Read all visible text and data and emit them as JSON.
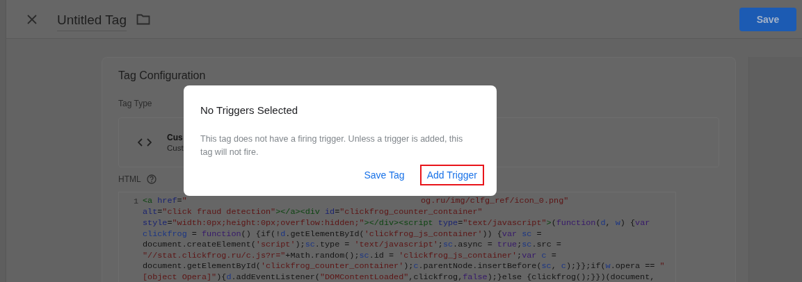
{
  "header": {
    "title": "Untitled Tag",
    "save_button": "Save"
  },
  "card": {
    "title": "Tag Configuration",
    "tag_type_label": "Tag Type",
    "tag_type": {
      "name": "Cus",
      "description": "Cust"
    },
    "html_label": "HTML"
  },
  "code": {
    "lines": [
      {
        "number": "1",
        "runs": [
          [
            {
              "text": "<a",
              "kind": "tag"
            },
            {
              "text": " href",
              "kind": "attr"
            },
            {
              "text": "=",
              "kind": "plain"
            },
            {
              "text": "\"",
              "kind": "string"
            }
          ],
          [
            {
              "text": "og.ru/img/clfg_ref/icon_0.png\"",
              "kind": "string"
            }
          ]
        ]
      },
      {
        "runs": [
          [
            {
              "text": "alt",
              "kind": "attr"
            },
            {
              "text": "=",
              "kind": "plain"
            },
            {
              "text": "\"click fraud detection\"",
              "kind": "string"
            },
            {
              "text": "></a><div",
              "kind": "tag"
            },
            {
              "text": " id",
              "kind": "attr"
            },
            {
              "text": "=",
              "kind": "plain"
            },
            {
              "text": "\"clickfrog_counter_container\"",
              "kind": "string"
            }
          ]
        ]
      },
      {
        "runs": [
          [
            {
              "text": "style",
              "kind": "attr"
            },
            {
              "text": "=",
              "kind": "plain"
            },
            {
              "text": "\"width:0px;height:0px;overflow:hidden;\"",
              "kind": "string"
            },
            {
              "text": "></div><script",
              "kind": "tag"
            },
            {
              "text": " type",
              "kind": "attr"
            },
            {
              "text": "=",
              "kind": "plain"
            },
            {
              "text": "\"text/javascript\"",
              "kind": "string"
            },
            {
              "text": ">",
              "kind": "tag"
            },
            {
              "text": "(",
              "kind": "plain"
            },
            {
              "text": "function",
              "kind": "keyword"
            },
            {
              "text": "(",
              "kind": "plain"
            },
            {
              "text": "d",
              "kind": "var"
            },
            {
              "text": ", ",
              "kind": "plain"
            },
            {
              "text": "w",
              "kind": "var"
            },
            {
              "text": ") {",
              "kind": "plain"
            },
            {
              "text": "var",
              "kind": "keyword"
            }
          ]
        ]
      },
      {
        "runs": [
          [
            {
              "text": "clickfrog",
              "kind": "var"
            },
            {
              "text": " = ",
              "kind": "plain"
            },
            {
              "text": "function",
              "kind": "keyword"
            },
            {
              "text": "() {if(!",
              "kind": "plain"
            },
            {
              "text": "d",
              "kind": "var"
            },
            {
              "text": ".getElementById(",
              "kind": "plain"
            },
            {
              "text": "'clickfrog_js_container'",
              "kind": "string"
            },
            {
              "text": ")) {",
              "kind": "plain"
            },
            {
              "text": "var",
              "kind": "keyword"
            },
            {
              "text": " sc",
              "kind": "var"
            },
            {
              "text": " =",
              "kind": "plain"
            }
          ]
        ]
      },
      {
        "runs": [
          [
            {
              "text": "document.createElement(",
              "kind": "plain"
            },
            {
              "text": "'script'",
              "kind": "string"
            },
            {
              "text": ");",
              "kind": "plain"
            },
            {
              "text": "sc",
              "kind": "var"
            },
            {
              "text": ".type = ",
              "kind": "plain"
            },
            {
              "text": "'text/javascript'",
              "kind": "string"
            },
            {
              "text": ";",
              "kind": "plain"
            },
            {
              "text": "sc",
              "kind": "var"
            },
            {
              "text": ".async = ",
              "kind": "plain"
            },
            {
              "text": "true",
              "kind": "keyword"
            },
            {
              "text": ";",
              "kind": "plain"
            },
            {
              "text": "sc",
              "kind": "var"
            },
            {
              "text": ".src =",
              "kind": "plain"
            }
          ]
        ]
      },
      {
        "runs": [
          [
            {
              "text": "\"//stat.clickfrog.ru/c.js?r=\"",
              "kind": "string"
            },
            {
              "text": "+Math.random();",
              "kind": "plain"
            },
            {
              "text": "sc",
              "kind": "var"
            },
            {
              "text": ".id = ",
              "kind": "plain"
            },
            {
              "text": "'clickfrog_js_container'",
              "kind": "string"
            },
            {
              "text": ";",
              "kind": "plain"
            },
            {
              "text": "var",
              "kind": "keyword"
            },
            {
              "text": " c",
              "kind": "var"
            },
            {
              "text": " =",
              "kind": "plain"
            }
          ]
        ]
      },
      {
        "runs": [
          [
            {
              "text": "document.getElementById(",
              "kind": "plain"
            },
            {
              "text": "'clickfrog_counter_container'",
              "kind": "string"
            },
            {
              "text": ");",
              "kind": "plain"
            },
            {
              "text": "c",
              "kind": "var"
            },
            {
              "text": ".parentNode.insertBefore(",
              "kind": "plain"
            },
            {
              "text": "sc",
              "kind": "var"
            },
            {
              "text": ", ",
              "kind": "plain"
            },
            {
              "text": "c",
              "kind": "var"
            },
            {
              "text": ");}};if(",
              "kind": "plain"
            },
            {
              "text": "w",
              "kind": "var"
            },
            {
              "text": ".opera == ",
              "kind": "plain"
            },
            {
              "text": "\"",
              "kind": "string"
            }
          ]
        ]
      },
      {
        "runs": [
          [
            {
              "text": "[object Opera]\"",
              "kind": "string"
            },
            {
              "text": "){",
              "kind": "plain"
            },
            {
              "text": "d",
              "kind": "var"
            },
            {
              "text": ".addEventListener(",
              "kind": "plain"
            },
            {
              "text": "\"DOMContentLoaded\"",
              "kind": "string"
            },
            {
              "text": ",clickfrog,",
              "kind": "plain"
            },
            {
              "text": "false",
              "kind": "keyword"
            },
            {
              "text": ");}else {clickfrog();}})(document,",
              "kind": "plain"
            }
          ]
        ]
      }
    ]
  },
  "dialog": {
    "title": "No Triggers Selected",
    "message": "This tag does not have a firing trigger. Unless a trigger is added, this tag will not fire.",
    "actions": [
      {
        "label": "Save Tag",
        "highlighted": false
      },
      {
        "label": "Add Trigger",
        "highlighted": true
      }
    ]
  }
}
